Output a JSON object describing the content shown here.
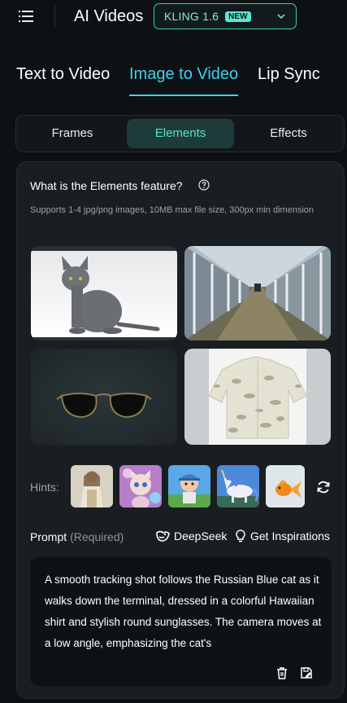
{
  "header": {
    "title": "AI Videos",
    "model": {
      "name": "KLING 1.6",
      "badge": "NEW"
    }
  },
  "tabs": [
    "Text to Video",
    "Image to Video",
    "Lip Sync"
  ],
  "active_tab": "Image to Video",
  "subtabs": [
    "Frames",
    "Elements",
    "Effects"
  ],
  "active_subtab": "Elements",
  "elements": {
    "question": "What is the Elements feature?",
    "info": "Supports 1-4 jpg/png images, 10MB max file size, 300px min dimension",
    "images": [
      "cat",
      "terminal",
      "sunglasses",
      "shirt"
    ]
  },
  "hints": {
    "label": "Hints:",
    "items": [
      "woman",
      "kitten",
      "cartoon-boy",
      "unicorn",
      "goldfish"
    ]
  },
  "prompt": {
    "label": "Prompt",
    "required": "(Required)",
    "deepseek": "DeepSeek",
    "inspirations": "Get Inspirations",
    "text": "A smooth tracking shot follows the Russian Blue cat as it walks down the terminal, dressed in a colorful Hawaiian shirt and stylish round sunglasses. The camera moves at a low angle, emphasizing the cat's"
  },
  "colors": {
    "accent": "#3fd3ea",
    "teal": "#55e0c6",
    "bg": "#0e1114"
  }
}
